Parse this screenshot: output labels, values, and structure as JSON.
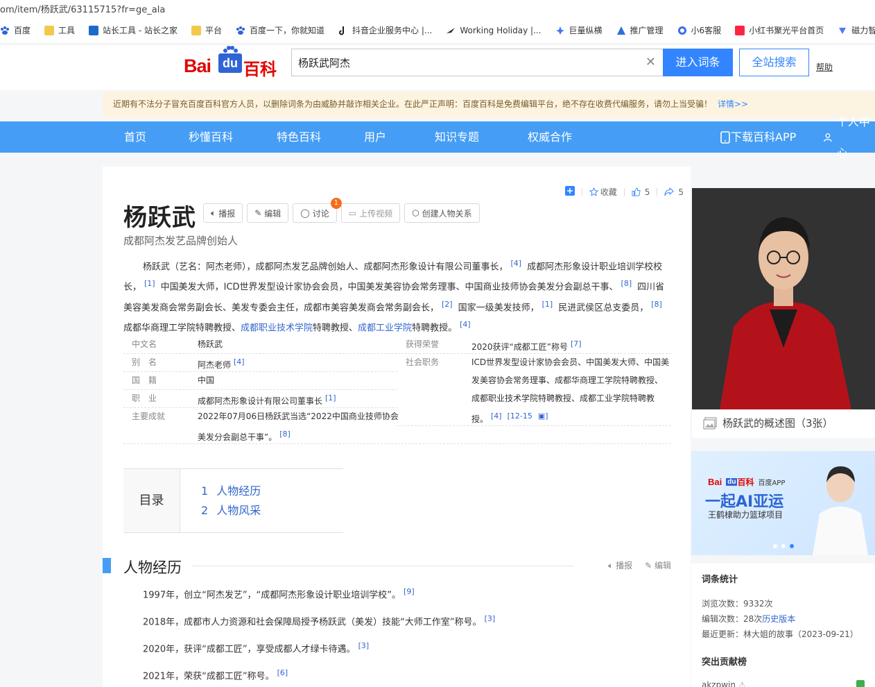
{
  "url": "om/item/杨跃武/63115715?fr=ge_ala",
  "bookmarks": [
    {
      "label": "百度",
      "icon": "paw-icon",
      "color": "#2f64d4"
    },
    {
      "label": "工具",
      "icon": "folder-icon",
      "color": "#f2c94c"
    },
    {
      "label": "站长工具 - 站长之家",
      "icon": "site-tool-icon",
      "color": "#1b6ac9"
    },
    {
      "label": "平台",
      "icon": "folder-icon",
      "color": "#f2c94c"
    },
    {
      "label": "百度一下，你就知道",
      "icon": "paw-icon",
      "color": "#2f64d4"
    },
    {
      "label": "抖音企业服务中心 |...",
      "icon": "douyin-icon",
      "color": "#1a1a1a"
    },
    {
      "label": "Working Holiday |...",
      "icon": "bird-icon",
      "color": "#333333"
    },
    {
      "label": "巨量纵横",
      "icon": "star-icon",
      "color": "#3b7cf0"
    },
    {
      "label": "推广管理",
      "icon": "triangle-icon",
      "color": "#2e6fd9"
    },
    {
      "label": "小6客服",
      "icon": "chat-icon",
      "color": "#3d6ee8"
    },
    {
      "label": "小红书聚光平台首页",
      "icon": "xiaohongshu-icon",
      "color": "#ff2442"
    },
    {
      "label": "磁力智",
      "icon": "magnet-icon",
      "color": "#4a7df0"
    }
  ],
  "header": {
    "logo_text_1": "Bai",
    "logo_text_du": "du",
    "logo_text_2": "百科",
    "search_value": "杨跃武阿杰",
    "enter_button": "进入词条",
    "search_all_button": "全站搜索",
    "help": "帮助"
  },
  "notice": {
    "text": "近期有不法分子冒充百度百科官方人员，以删除词条为由威胁并敲诈相关企业。在此严正声明：百度百科是免费编辑平台，绝不存在收费代编服务，请勿上当受骗！",
    "more": "详情>>"
  },
  "nav": {
    "items": [
      "首页",
      "秒懂百科",
      "特色百科",
      "用户",
      "知识专题",
      "权威合作"
    ],
    "download": "下载百科APP",
    "user": "个人中心"
  },
  "colors": {
    "accent": "#3385ff",
    "nav": "#459df5",
    "brand_red": "#e10601",
    "link": "#3366cc",
    "notice_bg": "#fcf4e0"
  },
  "entry": {
    "title": "杨跃武",
    "subtitle": "成都阿杰发艺品牌创始人",
    "actions": {
      "broadcast": "播报",
      "edit": "编辑",
      "discuss": "讨论",
      "discuss_badge": "1",
      "upload_video": "上传视频",
      "relation": "创建人物关系"
    },
    "tools": {
      "collect": "收藏",
      "likes": "5",
      "shares": "5"
    },
    "summary": {
      "p1": "杨跃武（艺名：阿杰老师），成都阿杰发艺品牌创始人、成都阿杰形象设计有限公司董事长，",
      "r1": "[4]",
      "p2": "成都阿杰形象设计职业培训学校校长，",
      "r2": "[1]",
      "p3": "中国美发大师，ICD世界发型设计家协会会员，中国美发美容协会常务理事、中国商业技师协会美发分会副总干事、",
      "r3": "[8]",
      "p4": "四川省美容美发商会常务副会长、美发专委会主任，成都市美容美发商会常务副会长，",
      "r4": "[2]",
      "p5": "国家一级美发技师，",
      "r5": "[1]",
      "p6": "民进武侯区总支委员，",
      "r6": "[8]",
      "p7": "成都华商理工学院特聘教授、",
      "l1": "成都职业技术学院",
      "p8": "特聘教授、",
      "l2": "成都工业学院",
      "p9": "特聘教授。",
      "r7": "[4]"
    },
    "infobox": {
      "name_label": "中文名",
      "name_value": "杨跃武",
      "alias_label": "别　名",
      "alias_value": "阿杰老师",
      "alias_ref": "[4]",
      "nation_label": "国　籍",
      "nation_value": "中国",
      "job_label": "职　业",
      "job_value": "成都阿杰形象设计有限公司董事长",
      "job_ref": "[1]",
      "achieve_label": "主要成就",
      "achieve_line1": "2022年07月06日杨跃武当选“2022中国商业技师协会",
      "achieve_line2": "美发分会副总干事”。",
      "achieve_ref": "[8]",
      "honor_label": "获得荣誉",
      "honor_value": "2020获评“成都工匠”称号",
      "honor_ref": "[7]",
      "duty_label": "社会职务",
      "duty_line1": "ICD世界发型设计家协会会员、中国美发大师、中国美",
      "duty_line2": "发美容协会常务理事、成都华商理工学院特聘教授、",
      "duty_line3": "成都职业技术学院特聘教授、成都工业学院特聘教",
      "duty_line4": "授。",
      "duty_ref1": "[4]",
      "duty_ref2": "[12-15"
    },
    "toc": {
      "label": "目录",
      "items": [
        {
          "num": "1",
          "text": "人物经历"
        },
        {
          "num": "2",
          "text": "人物风采"
        }
      ]
    },
    "section1": {
      "title": "人物经历",
      "broadcast": "播报",
      "edit": "编辑",
      "items": [
        {
          "text": "1997年，创立“阿杰发艺”，“成都阿杰形象设计职业培训学校”。",
          "ref": "[9]"
        },
        {
          "text": "2018年，成都市人力资源和社会保障局授予杨跃武（美发）技能“大师工作室”称号。",
          "ref": "[3]"
        },
        {
          "text": "2020年，获评“成都工匠”，享受成都人才绿卡待遇。",
          "ref": "[3]"
        },
        {
          "text": "2021年，荣获“成都工匠”称号。",
          "ref": "[6]"
        }
      ]
    }
  },
  "sidebar": {
    "photo_caption": "杨跃武的概述图（3张）",
    "ad": {
      "brand": "Bai",
      "brand_du": "du",
      "brand_baike": "百科",
      "app": "百度APP",
      "headline": "一起AI亚运",
      "sub": "王鹤棣助力篮球项目"
    },
    "stats": {
      "title": "词条统计",
      "views_label": "浏览次数：",
      "views": "9332次",
      "edits_label": "编辑次数：",
      "edits": "28次",
      "history": "历史版本",
      "updated_label": "最近更新：",
      "updated_by": "林大姐的故事",
      "updated_date": "（2023-09-21）",
      "contrib_title": "突出贡献榜",
      "contributor": "akzpwjn"
    }
  }
}
